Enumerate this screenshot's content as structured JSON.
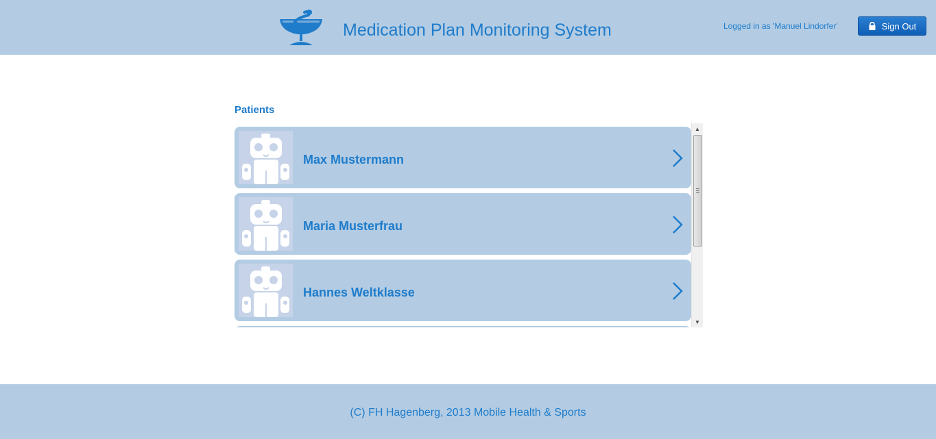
{
  "header": {
    "title": "Medication Plan Monitoring System",
    "logged_in_text": "Logged in as 'Manuel Lindorfer'",
    "sign_out_label": "Sign Out",
    "logo_icon": "caduceus-icon",
    "sign_out_icon": "lock-icon"
  },
  "main": {
    "section_title": "Patients",
    "patients": [
      {
        "name": "Max Mustermann",
        "avatar_icon": "robot-avatar-icon"
      },
      {
        "name": "Maria Musterfrau",
        "avatar_icon": "robot-avatar-icon"
      },
      {
        "name": "Hannes Weltklasse",
        "avatar_icon": "robot-avatar-icon"
      }
    ]
  },
  "footer": {
    "text": "(C) FH Hagenberg, 2013 Mobile Health & Sports"
  },
  "colors": {
    "header_bg": "#b3cce3",
    "accent": "#1f7ccb",
    "button_bg": "#1565c0",
    "avatar_bg": "#c6d3e8"
  }
}
